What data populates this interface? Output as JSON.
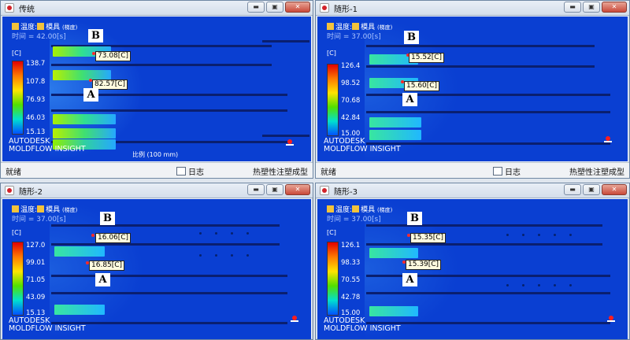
{
  "windows": [
    {
      "title": "传统",
      "toolbar": {
        "main": "温度",
        "sep": ":",
        "sub": "模具",
        "sub2": "(梯度)"
      },
      "time": "时间 = 42.00[s]",
      "unit": "[C]",
      "scale": [
        "138.7",
        "107.8",
        "76.93",
        "46.03",
        "15.13"
      ],
      "labels": {
        "b_value": "73.08[C]",
        "a_value": "82.57[C]",
        "b_letter": "B",
        "a_letter": "A"
      },
      "logo": [
        "AUTODESK",
        "MOLDFLOW INSIGHT"
      ],
      "scale_bar": "比例 (100 mm)",
      "status": {
        "ready": "就绪",
        "log": "日志",
        "type": "热塑性注塑成型"
      }
    },
    {
      "title": "随形-1",
      "toolbar": {
        "main": "温度",
        "sep": ":",
        "sub": "模具",
        "sub2": "(梯度)"
      },
      "time": "时间 = 37.00[s]",
      "unit": "[C]",
      "scale": [
        "126.4",
        "98.52",
        "70.68",
        "42.84",
        "15.00"
      ],
      "labels": {
        "b_value": "15.52[C]",
        "a_value": "15.60[C]",
        "b_letter": "B",
        "a_letter": "A"
      },
      "logo": [
        "AUTODESK",
        "MOLDFLOW INSIGHT"
      ],
      "status": {
        "ready": "就绪",
        "log": "日志",
        "type": "热塑性注塑成型"
      }
    },
    {
      "title": "随形-2",
      "toolbar": {
        "main": "温度",
        "sep": ":",
        "sub": "模具",
        "sub2": "(梯度)"
      },
      "time": "时间 = 37.00[s]",
      "unit": "[C]",
      "scale": [
        "127.0",
        "99.01",
        "71.05",
        "43.09",
        "15.13"
      ],
      "labels": {
        "b_value": "16.06[C]",
        "a_value": "16.85[C]",
        "b_letter": "B",
        "a_letter": "A"
      },
      "logo": [
        "AUTODESK",
        "MOLDFLOW INSIGHT"
      ]
    },
    {
      "title": "随形-3",
      "toolbar": {
        "main": "温度",
        "sep": ":",
        "sub": "模具",
        "sub2": "(梯度)"
      },
      "time": "时间 = 37.00[s]",
      "unit": "[C]",
      "scale": [
        "126.1",
        "98.33",
        "70.55",
        "42.78",
        "15.00"
      ],
      "labels": {
        "b_value": "15.35[C]",
        "a_value": "15.39[C]",
        "b_letter": "B",
        "a_letter": "A"
      },
      "logo": [
        "AUTODESK",
        "MOLDFLOW INSIGHT"
      ]
    }
  ],
  "window_buttons": {
    "minimize": "▬",
    "restore": "▣",
    "close": "✕"
  }
}
